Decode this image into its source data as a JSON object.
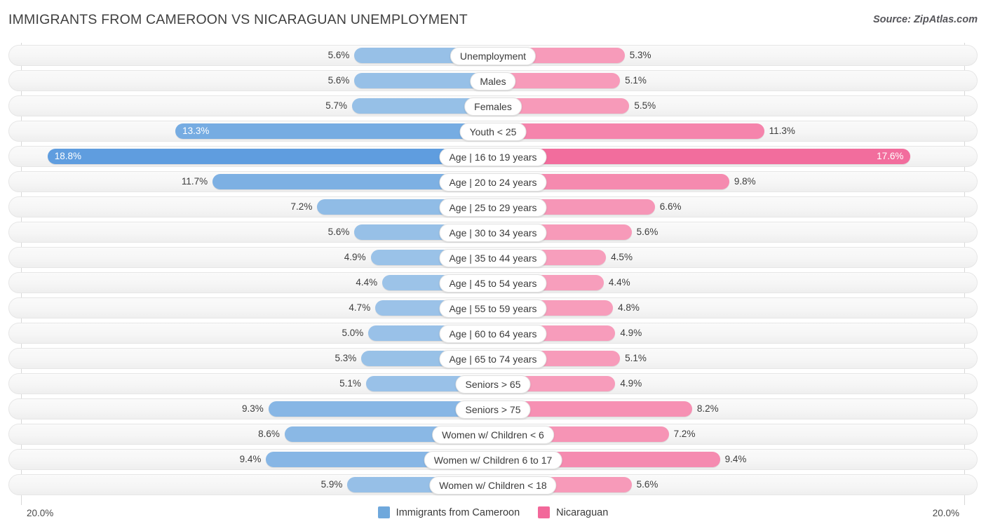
{
  "header": {
    "title": "IMMIGRANTS FROM CAMEROON VS NICARAGUAN UNEMPLOYMENT",
    "source": "Source: ZipAtlas.com"
  },
  "axis": {
    "left_max_label": "20.0%",
    "right_max_label": "20.0%",
    "max_value": 20.0
  },
  "legend": {
    "items": [
      {
        "label": "Immigrants from Cameroon",
        "color": "#6fa8dc"
      },
      {
        "label": "Nicaraguan",
        "color": "#f2689a"
      }
    ]
  },
  "colors": {
    "left_light": "#9cc3e8",
    "left_dark": "#5f9ddf",
    "right_light": "#f79ebc",
    "right_dark": "#f2689a",
    "track": "#f5f5f5",
    "gridline": "#d8d8d8"
  },
  "chart_data": {
    "type": "bar",
    "orientation": "horizontal-diverging",
    "title": "IMMIGRANTS FROM CAMEROON VS NICARAGUAN UNEMPLOYMENT",
    "xlabel": "",
    "ylabel": "",
    "xlim": [
      0,
      20.0
    ],
    "grid": true,
    "legend_position": "bottom-center",
    "categories": [
      "Unemployment",
      "Males",
      "Females",
      "Youth < 25",
      "Age | 16 to 19 years",
      "Age | 20 to 24 years",
      "Age | 25 to 29 years",
      "Age | 30 to 34 years",
      "Age | 35 to 44 years",
      "Age | 45 to 54 years",
      "Age | 55 to 59 years",
      "Age | 60 to 64 years",
      "Age | 65 to 74 years",
      "Seniors > 65",
      "Seniors > 75",
      "Women w/ Children < 6",
      "Women w/ Children 6 to 17",
      "Women w/ Children < 18"
    ],
    "series": [
      {
        "name": "Immigrants from Cameroon",
        "color": "#6fa8dc",
        "values": [
          5.6,
          5.6,
          5.7,
          13.3,
          18.8,
          11.7,
          7.2,
          5.6,
          4.9,
          4.4,
          4.7,
          5.0,
          5.3,
          5.1,
          9.3,
          8.6,
          9.4,
          5.9
        ],
        "labels": [
          "5.6%",
          "5.6%",
          "5.7%",
          "13.3%",
          "18.8%",
          "11.7%",
          "7.2%",
          "5.6%",
          "4.9%",
          "4.4%",
          "4.7%",
          "5.0%",
          "5.3%",
          "5.1%",
          "9.3%",
          "8.6%",
          "9.4%",
          "5.9%"
        ]
      },
      {
        "name": "Nicaraguan",
        "color": "#f2689a",
        "values": [
          5.3,
          5.1,
          5.5,
          11.3,
          17.6,
          9.8,
          6.6,
          5.6,
          4.5,
          4.4,
          4.8,
          4.9,
          5.1,
          4.9,
          8.2,
          7.2,
          9.4,
          5.6
        ],
        "labels": [
          "5.3%",
          "5.1%",
          "5.5%",
          "11.3%",
          "17.6%",
          "9.8%",
          "6.6%",
          "5.6%",
          "4.5%",
          "4.4%",
          "4.8%",
          "4.9%",
          "5.1%",
          "4.9%",
          "8.2%",
          "7.2%",
          "9.4%",
          "5.6%"
        ]
      }
    ],
    "rows": [
      {
        "label": "Unemployment",
        "left": 5.6,
        "left_label": "5.6%",
        "left_inside": false,
        "right": 5.3,
        "right_label": "5.3%",
        "right_inside": false
      },
      {
        "label": "Males",
        "left": 5.6,
        "left_label": "5.6%",
        "left_inside": false,
        "right": 5.1,
        "right_label": "5.1%",
        "right_inside": false
      },
      {
        "label": "Females",
        "left": 5.7,
        "left_label": "5.7%",
        "left_inside": false,
        "right": 5.5,
        "right_label": "5.5%",
        "right_inside": false
      },
      {
        "label": "Youth < 25",
        "left": 13.3,
        "left_label": "13.3%",
        "left_inside": true,
        "right": 11.3,
        "right_label": "11.3%",
        "right_inside": false
      },
      {
        "label": "Age | 16 to 19 years",
        "left": 18.8,
        "left_label": "18.8%",
        "left_inside": true,
        "right": 17.6,
        "right_label": "17.6%",
        "right_inside": true
      },
      {
        "label": "Age | 20 to 24 years",
        "left": 11.7,
        "left_label": "11.7%",
        "left_inside": false,
        "right": 9.8,
        "right_label": "9.8%",
        "right_inside": false
      },
      {
        "label": "Age | 25 to 29 years",
        "left": 7.2,
        "left_label": "7.2%",
        "left_inside": false,
        "right": 6.6,
        "right_label": "6.6%",
        "right_inside": false
      },
      {
        "label": "Age | 30 to 34 years",
        "left": 5.6,
        "left_label": "5.6%",
        "left_inside": false,
        "right": 5.6,
        "right_label": "5.6%",
        "right_inside": false
      },
      {
        "label": "Age | 35 to 44 years",
        "left": 4.9,
        "left_label": "4.9%",
        "left_inside": false,
        "right": 4.5,
        "right_label": "4.5%",
        "right_inside": false
      },
      {
        "label": "Age | 45 to 54 years",
        "left": 4.4,
        "left_label": "4.4%",
        "left_inside": false,
        "right": 4.4,
        "right_label": "4.4%",
        "right_inside": false
      },
      {
        "label": "Age | 55 to 59 years",
        "left": 4.7,
        "left_label": "4.7%",
        "left_inside": false,
        "right": 4.8,
        "right_label": "4.8%",
        "right_inside": false
      },
      {
        "label": "Age | 60 to 64 years",
        "left": 5.0,
        "left_label": "5.0%",
        "left_inside": false,
        "right": 4.9,
        "right_label": "4.9%",
        "right_inside": false
      },
      {
        "label": "Age | 65 to 74 years",
        "left": 5.3,
        "left_label": "5.3%",
        "left_inside": false,
        "right": 5.1,
        "right_label": "5.1%",
        "right_inside": false
      },
      {
        "label": "Seniors > 65",
        "left": 5.1,
        "left_label": "5.1%",
        "left_inside": false,
        "right": 4.9,
        "right_label": "4.9%",
        "right_inside": false
      },
      {
        "label": "Seniors > 75",
        "left": 9.3,
        "left_label": "9.3%",
        "left_inside": false,
        "right": 8.2,
        "right_label": "8.2%",
        "right_inside": false
      },
      {
        "label": "Women w/ Children < 6",
        "left": 8.6,
        "left_label": "8.6%",
        "left_inside": false,
        "right": 7.2,
        "right_label": "7.2%",
        "right_inside": false
      },
      {
        "label": "Women w/ Children 6 to 17",
        "left": 9.4,
        "left_label": "9.4%",
        "left_inside": false,
        "right": 9.4,
        "right_label": "9.4%",
        "right_inside": false
      },
      {
        "label": "Women w/ Children < 18",
        "left": 5.9,
        "left_label": "5.9%",
        "left_inside": false,
        "right": 5.6,
        "right_label": "5.6%",
        "right_inside": false
      }
    ]
  }
}
